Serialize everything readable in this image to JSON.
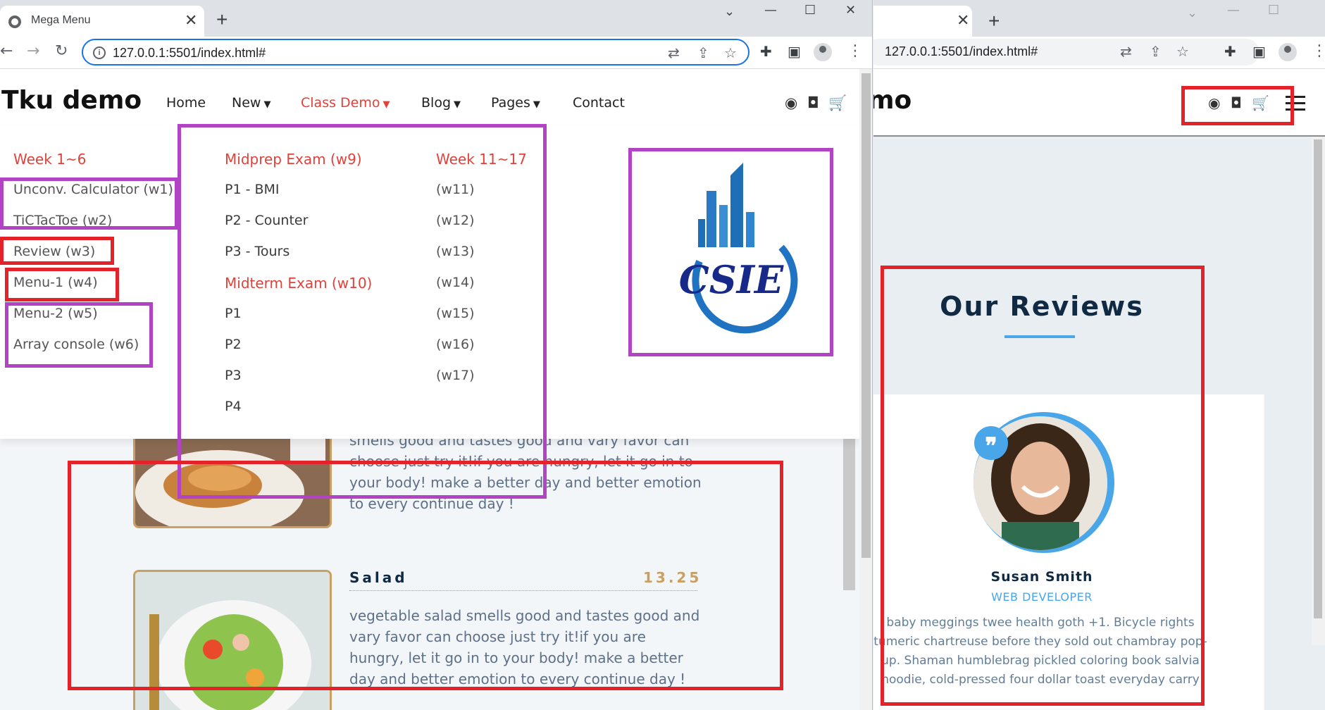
{
  "left_browser": {
    "tab_title": "Mega Menu",
    "url": "127.0.0.1:5501/index.html#"
  },
  "right_browser": {
    "url": "127.0.0.1:5501/index.html#"
  },
  "site": {
    "brand": "Tku demo",
    "nav": [
      {
        "label": "Home"
      },
      {
        "label": "New"
      },
      {
        "label": "Class Demo"
      },
      {
        "label": "Blog"
      },
      {
        "label": "Pages"
      },
      {
        "label": "Contact"
      }
    ],
    "header_icons": [
      "github-icon",
      "gitlab-icon",
      "cart-icon"
    ]
  },
  "mega_menu": {
    "col1": {
      "title": "Week 1~6",
      "items": [
        "Unconv. Calculator (w1)",
        "TiCTacToe (w2)",
        "Review (w3)",
        "Menu-1 (w4)",
        "Menu-2 (w5)",
        "Array console (w6)"
      ]
    },
    "col2": {
      "title": "Midprep Exam (w9)",
      "items": [
        "P1 - BMI",
        "P2 - Counter",
        "P3 - Tours"
      ],
      "title2": "Midterm Exam (w10)",
      "items2": [
        "P1",
        "P2",
        "P3",
        "P4"
      ]
    },
    "col3": {
      "title": "Week 11~17",
      "items": [
        "(w11)",
        "(w12)",
        "(w13)",
        "(w14)",
        "(w15)",
        "(w16)",
        "(w17)"
      ]
    },
    "logo_text": "CSIE"
  },
  "menu_items": [
    {
      "name": "",
      "price": "",
      "desc": "smells good and tastes good and vary favor can choose just try it!if you are hungry, let it go in to your body! make a better day and better emotion to every continue day !"
    },
    {
      "name": "Salad",
      "price": "13.25",
      "desc": "vegetable salad smells good and tastes good and vary favor can choose just try it!if you are hungry, let it go in to your body! make a better day and better emotion to every continue day !"
    }
  ],
  "right_page": {
    "brand_partial": "mo",
    "reviews_title": "Our Reviews",
    "author": "Susan Smith",
    "job": "WEB DEVELOPER",
    "review_text": "baby meggings twee health goth +1. Bicycle rights tumeric chartreuse before they sold out chambray pop-up. Shaman humblebrag pickled coloring book salvia hoodie, cold-pressed four dollar toast everyday carry"
  },
  "colors": {
    "accent": "#e0413a",
    "highlight_red": "#e3222a",
    "highlight_purple": "#b143c4",
    "review_blue": "#49a6e9",
    "price_gold": "#c9a062"
  }
}
